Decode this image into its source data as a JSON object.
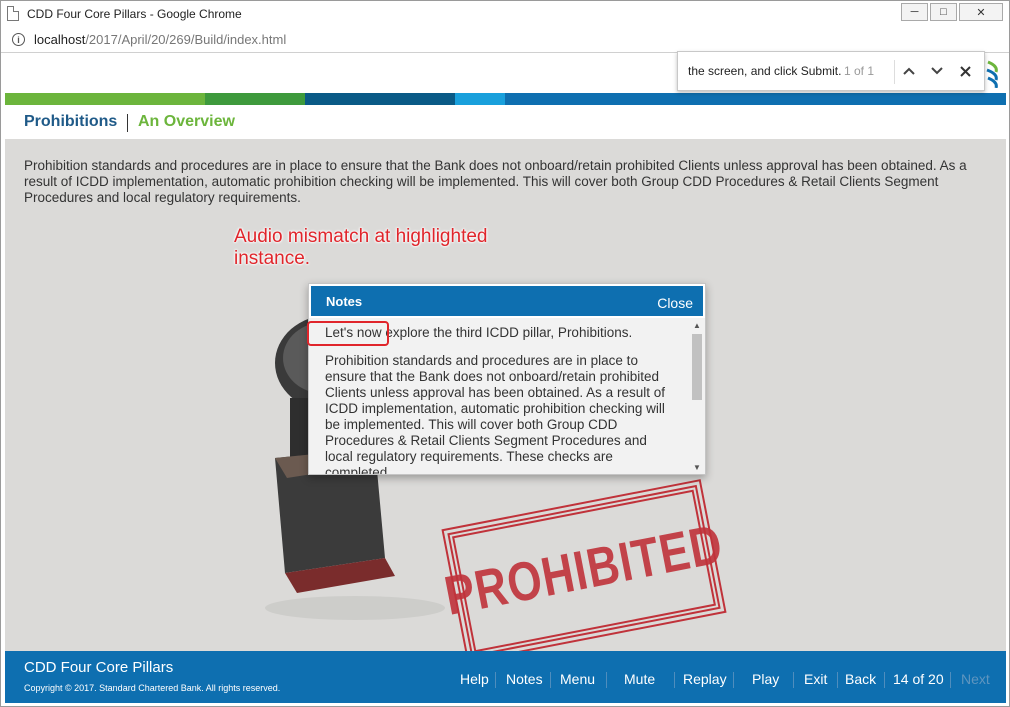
{
  "window": {
    "title": "CDD Four Core Pillars - Google Chrome",
    "minimize": "─",
    "restore": "□",
    "close": "✕"
  },
  "address": {
    "host": "localhost",
    "path": "/2017/April/20/269/Build/index.html"
  },
  "findbar": {
    "query": "the screen, and click Submit.",
    "count": "1 of 1",
    "prev_icon": "⌃",
    "next_icon": "⌄",
    "close_icon": "✕"
  },
  "header": {
    "title": "Prohibitions",
    "subtitle": "An Overview"
  },
  "body_text": "Prohibition standards and procedures are in place to ensure that the Bank does not onboard/retain prohibited Clients unless approval has been obtained. As a result of ICDD implementation, automatic prohibition checking will be implemented. This will cover both Group CDD Procedures & Retail Clients Segment Procedures and local regulatory requirements.",
  "annotation": "Audio mismatch at highlighted instance.",
  "stamp_text": "PROHIBITED",
  "notes": {
    "title": "Notes",
    "close": "Close",
    "para1": "Let's now explore the third ICDD pillar, Prohibitions.",
    "para2": "Prohibition standards and procedures are in place to ensure that the Bank does not onboard/retain prohibited Clients unless approval has been obtained. As a result of ICDD implementation, automatic prohibition checking will be implemented. This will cover both Group CDD Procedures & Retail Clients Segment Procedures and local regulatory requirements. These checks are completed"
  },
  "footer": {
    "course_title": "CDD Four Core Pillars",
    "copyright": "Copyright © 2017. Standard Chartered Bank. All rights reserved.",
    "help": "Help",
    "notes": "Notes",
    "menu": "Menu",
    "mute": "Mute",
    "replay": "Replay",
    "play": "Play",
    "exit": "Exit",
    "back": "Back",
    "page": "14 of 20",
    "next": "Next"
  },
  "colors": {
    "brand_blue": "#0e6fb0",
    "brand_green": "#6cb53c",
    "title_blue": "#1f5a88",
    "annotation_red": "#e0252b",
    "stamp_red": "#c0323a"
  }
}
